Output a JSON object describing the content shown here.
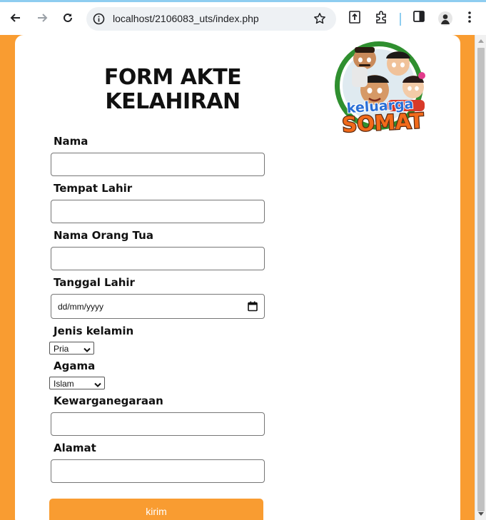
{
  "browser": {
    "url": "localhost/2106083_uts/index.php",
    "colors": {
      "accent": "#8ecdf0"
    },
    "icons": [
      "back-arrow-icon",
      "forward-arrow-icon",
      "reload-icon",
      "info-icon",
      "star-icon",
      "extension-upload-icon",
      "puzzle-icon",
      "sidebar-icon",
      "profile-avatar",
      "kebab-menu-icon"
    ]
  },
  "page": {
    "colors": {
      "background": "#f99c31",
      "card": "#ffffff",
      "button": "#f99c31"
    },
    "title_line1": "FORM AKTE",
    "title_line2": "KELAHIRAN",
    "logo": {
      "text_top": "keluarga",
      "text_bottom": "SOMAT"
    }
  },
  "form": {
    "nama_label": "Nama",
    "tempat_lahir_label": "Tempat Lahir",
    "nama_orang_tua_label": "Nama Orang Tua",
    "tanggal_lahir_label": "Tanggal Lahir",
    "tanggal_lahir_placeholder": "dd/mm/yyyy",
    "jenis_kelamin_label": "Jenis kelamin",
    "jenis_kelamin_value": "Pria",
    "agama_label": "Agama",
    "agama_value": "Islam",
    "kewarganegaraan_label": "Kewarganegaraan",
    "alamat_label": "Alamat",
    "submit_label": "kirim"
  }
}
